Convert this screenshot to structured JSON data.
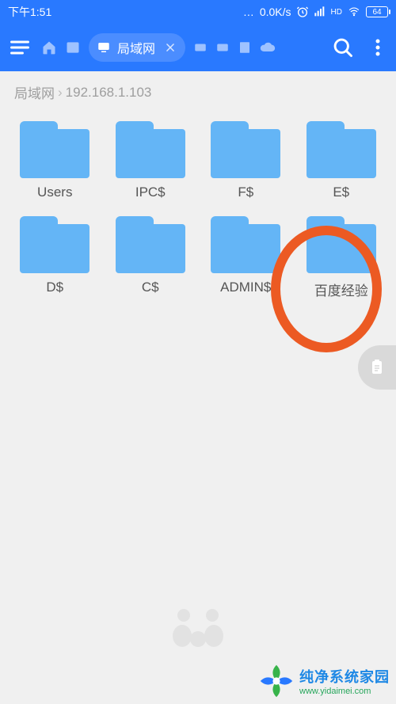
{
  "status": {
    "time": "下午1:51",
    "net_speed": "0.0K/s",
    "battery": "64"
  },
  "appbar": {
    "active_tab_label": "局域网"
  },
  "breadcrumb": {
    "root": "局域网",
    "path": "192.168.1.103"
  },
  "folders": [
    {
      "name": "Users"
    },
    {
      "name": "IPC$"
    },
    {
      "name": "F$"
    },
    {
      "name": "E$"
    },
    {
      "name": "D$"
    },
    {
      "name": "C$"
    },
    {
      "name": "ADMIN$"
    },
    {
      "name": "百度经验"
    }
  ],
  "annotation": {
    "highlight_index": 7
  },
  "brand": {
    "name": "纯净系统家园",
    "url": "www.yidaimei.com"
  }
}
